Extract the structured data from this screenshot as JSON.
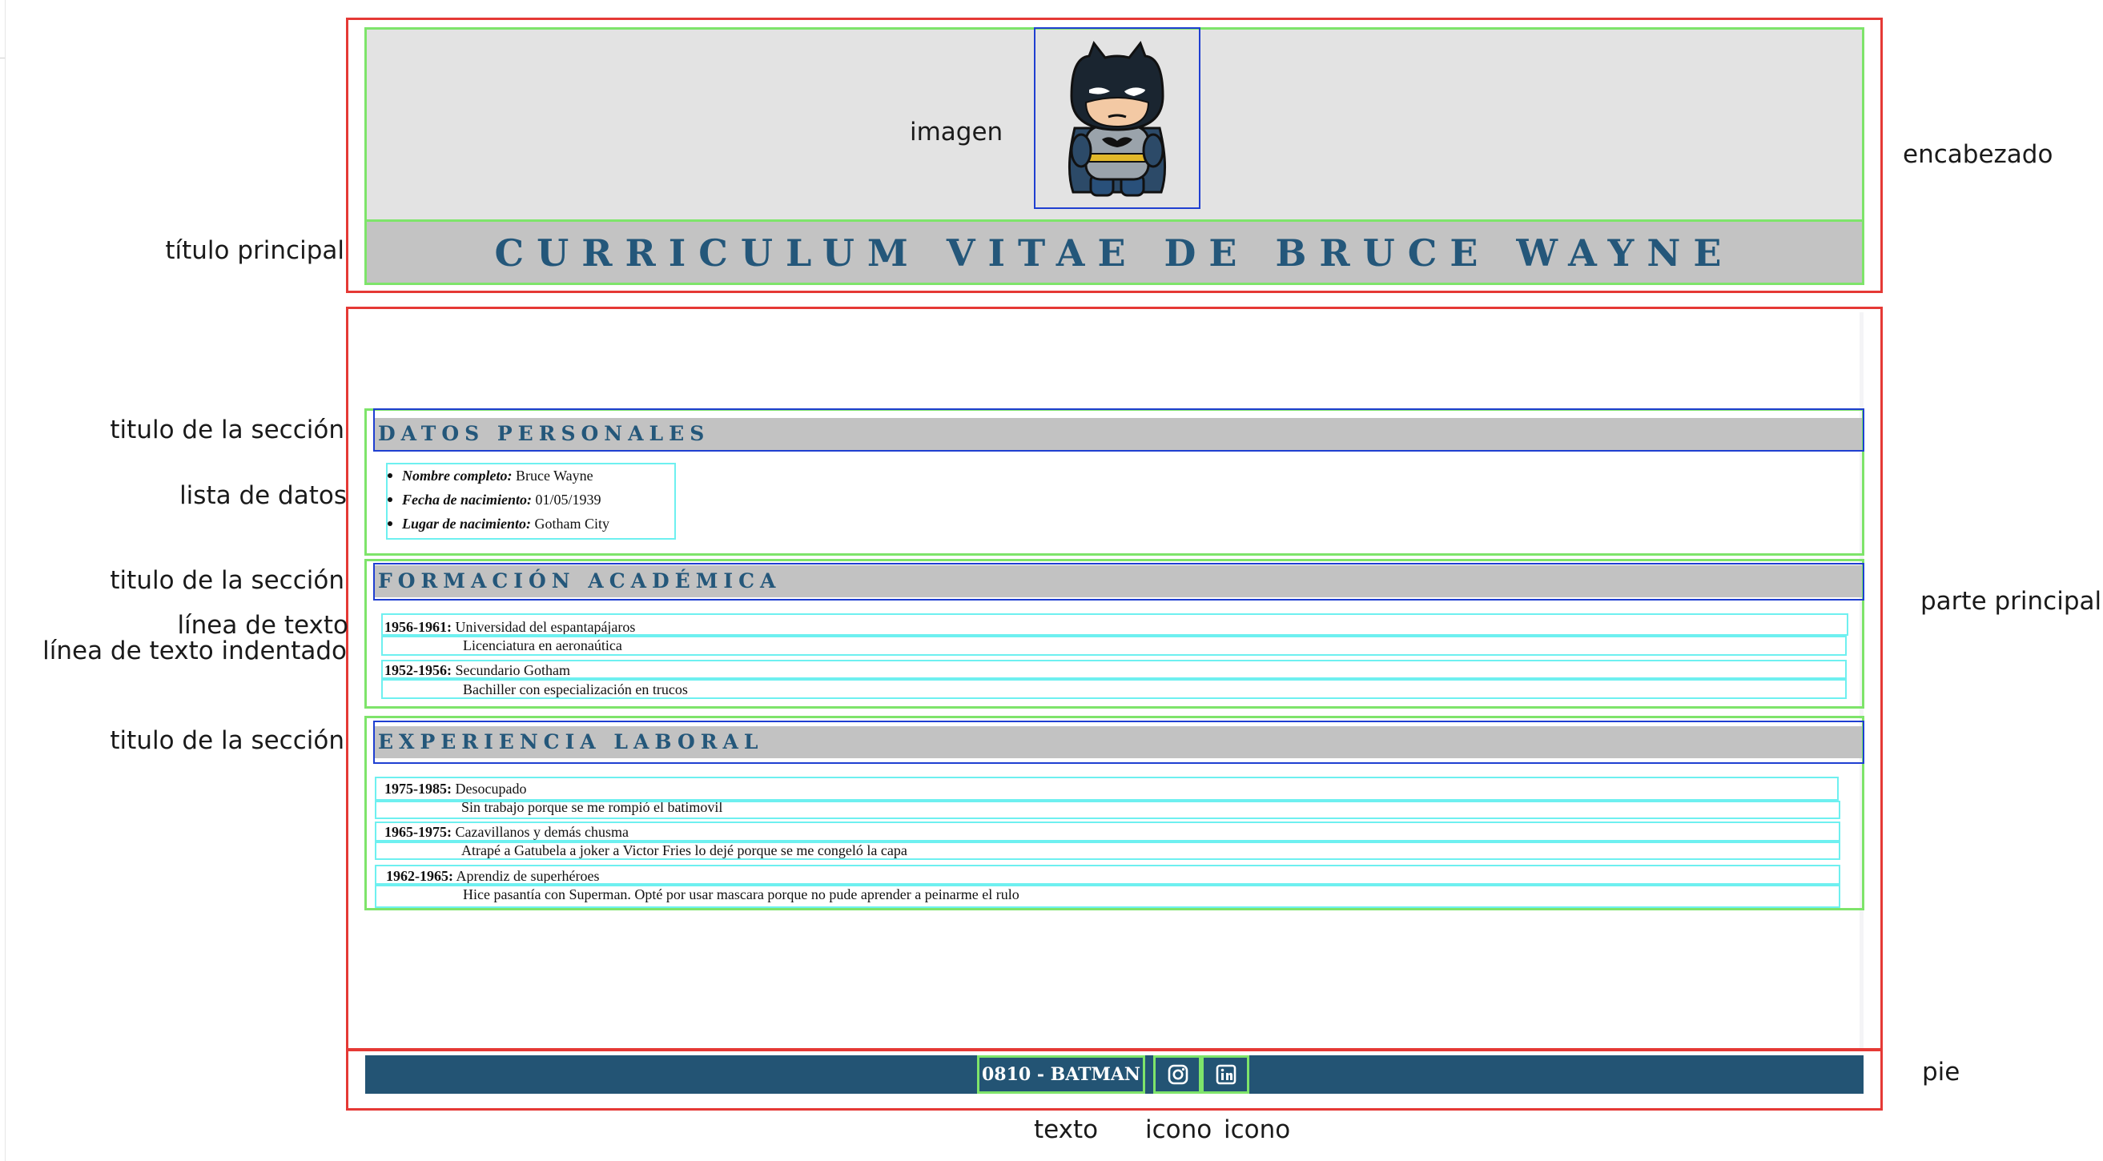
{
  "annotations": {
    "imagen": "imagen",
    "encabezado": "encabezado",
    "titulo_principal": "título principal",
    "titulo_seccion": "titulo de la sección",
    "lista_datos": "lista de datos",
    "linea_texto": "línea de texto",
    "linea_texto_indentado": "línea de texto indentado",
    "parte_principal": "parte principal",
    "pie": "pie",
    "texto": "texto",
    "icono": "icono"
  },
  "cv": {
    "title": "CURRICULUM VITAE DE BRUCE WAYNE",
    "image_icon": "batman-figure-icon",
    "sections": {
      "personal": {
        "title": "DATOS PERSONALES",
        "items": [
          {
            "label": "Nombre completo:",
            "value": "Bruce Wayne"
          },
          {
            "label": "Fecha de nacimiento:",
            "value": "01/05/1939"
          },
          {
            "label": "Lugar de nacimiento:",
            "value": "Gotham City"
          }
        ]
      },
      "education": {
        "title": "FORMACIÓN ACADÉMICA",
        "entries": [
          {
            "period": "1956-1961:",
            "place": "Universidad del espantapájaros",
            "detail": "Licenciatura en aeronaútica"
          },
          {
            "period": "1952-1956:",
            "place": "Secundario Gotham",
            "detail": "Bachiller con especialización en trucos"
          }
        ]
      },
      "work": {
        "title": "EXPERIENCIA LABORAL",
        "entries": [
          {
            "period": "1975-1985:",
            "place": "Desocupado",
            "detail": "Sin trabajo porque se me rompió el batimovil"
          },
          {
            "period": "1965-1975:",
            "place": "Cazavillanos y demás chusma",
            "detail": "Atrapé a Gatubela a joker a Victor Fries lo dejé porque se me congeló la capa"
          },
          {
            "period": "1962-1965:",
            "place": "Aprendiz de superhéroes",
            "detail": "Hice pasantía con Superman. Opté por usar mascara porque no pude aprender a peinarme el rulo"
          }
        ]
      }
    },
    "footer": {
      "text": "0810 - BATMAN",
      "icons": [
        "instagram-icon",
        "linkedin-icon"
      ]
    }
  },
  "colors": {
    "outer_boxes": "#e53935",
    "section_boxes": "#7ee46a",
    "title_boxes": "#1f3fd1",
    "line_boxes": "#6ef0f0",
    "title_text": "#24577a",
    "footer_bg": "#235474"
  }
}
